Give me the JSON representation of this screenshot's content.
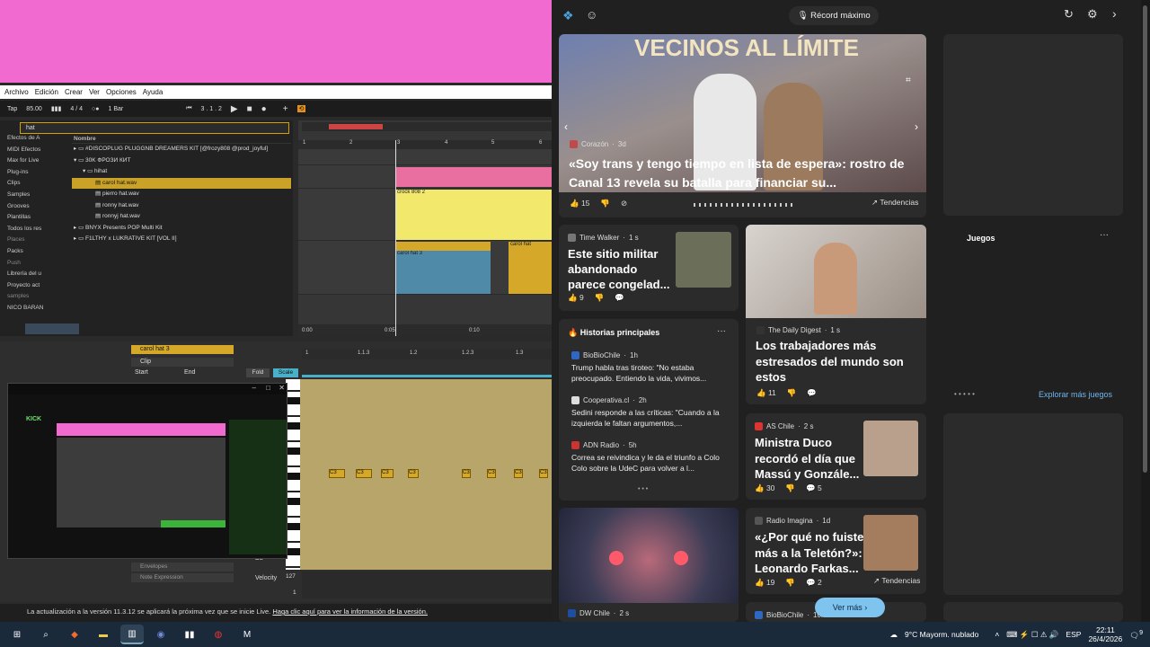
{
  "ableton": {
    "menu": [
      "Archivo",
      "Edición",
      "Crear",
      "Ver",
      "Opciones",
      "Ayuda"
    ],
    "transport": {
      "tap": "Tap",
      "bpm": "85.00",
      "signature": "4 / 4",
      "bar_mode": "1 Bar",
      "position": "3 . 1 . 2"
    },
    "search": {
      "value": "hat"
    },
    "places_top": [
      "Efectos de A",
      "MIDI Efectos",
      "Max for Live",
      "Plug-ins",
      "Clips",
      "Samples",
      "Grooves",
      "Plantillas",
      "Todos los res"
    ],
    "places_header": "Places",
    "places_bottom": [
      "Packs",
      "Push",
      "Librería del u",
      "Proyecto act",
      "samples",
      "NICO BARAN"
    ],
    "file_header": "Nombre",
    "files": [
      "#DISCOPLUG PLUGGNB DREAMERS KIT [@frozy808 @prod_joyful]",
      "30K ФРОЗИ КИТ",
      "hihat",
      "carol hat.wav",
      "pierro hat.wav",
      "ronny hat.wav",
      "ronnyj hat.wav",
      "BNYX Presents POP Multi Kit",
      "F1LTHY x LUKRATIVE KIT [VOL II]"
    ],
    "ruler": [
      "1",
      "2",
      "3",
      "4",
      "5",
      "6"
    ],
    "clips": {
      "c1": "crock 808 2",
      "c2": "carol hat 3",
      "c3": "carol hat"
    },
    "time_marks": [
      "0:00",
      "0:05",
      "0:10"
    ],
    "clip_panel": {
      "name": "carol hat 3",
      "clip": "Clip",
      "start": "Start",
      "end": "End"
    },
    "midi_ruler": [
      "1",
      "1.1.3",
      "1.2",
      "1.2.3",
      "1.3"
    ],
    "fold": "Fold",
    "scale": "Scale",
    "notes": [
      "C3",
      "C3",
      "C3",
      "C3",
      "C3",
      "C3",
      "C3",
      "C3"
    ],
    "envelopes": "Envelopes",
    "note_expression": "Note Expression",
    "velocity": "Velocity",
    "vel_max": "127",
    "vel_min": "1",
    "d2": "D2",
    "status": "La actualización a la versión 11.3.12 se aplicará la próxima vez que se inicie Live.",
    "status_link": "Haga clic aquí para ver la información de la versión.",
    "kick_title": "KICK"
  },
  "msn": {
    "search_pill": "Récord máximo",
    "hero": {
      "source": "Corazón",
      "age": "3d",
      "title": "«Soy trans y tengo tiempo en lista de espera»: rostro de Canal 13 revela su batalla para financiar su...",
      "likes": "15",
      "trend": "Tendencias",
      "banner": "VECINOS AL LÍMITE"
    },
    "card_military": {
      "source": "Time Walker",
      "age": "1 s",
      "title": "Este sitio militar abandonado parece congelad...",
      "likes": "9"
    },
    "card_workers": {
      "source": "The Daily Digest",
      "age": "1 s",
      "title": "Los trabajadores más estresados del mundo son estos",
      "likes": "11"
    },
    "historias": {
      "header": "Historias principales",
      "items": [
        {
          "source": "BioBioChile",
          "age": "1h",
          "text": "Trump habla tras tiroteo: \"No estaba preocupado. Entiendo la vida, vivimos..."
        },
        {
          "source": "Cooperativa.cl",
          "age": "2h",
          "text": "Sedini responde a las críticas: \"Cuando a la izquierda le faltan argumentos,..."
        },
        {
          "source": "ADN Radio",
          "age": "5h",
          "text": "Correa se reivindica y le da el triunfo a Colo Colo sobre la UdeC para volver a l..."
        }
      ]
    },
    "card_duco": {
      "source": "AS Chile",
      "age": "2 s",
      "title": "Ministra Duco recordó el día que Massú y Gonzále...",
      "likes": "30",
      "comments": "5"
    },
    "card_farkas": {
      "source": "Radio Imagina",
      "age": "1d",
      "title": "«¿Por qué no fuiste más a la Teletón?»: Leonardo Farkas...",
      "likes": "19",
      "comments": "2",
      "trend": "Tendencias"
    },
    "card_dw": {
      "source": "DW Chile",
      "age": "2 s"
    },
    "card_bio2": {
      "source": "BioBioChile",
      "age": "10h"
    },
    "juegos": {
      "title": "Juegos",
      "explore": "Explorar más juegos"
    },
    "ver_mas": "Ver más"
  },
  "taskbar": {
    "weather": "9°C  Mayorm. nublado",
    "lang": "ESP",
    "time": "22:11",
    "date": "26/4/2026",
    "notif_count": "9"
  },
  "colors": {
    "pink": "#f06ad0",
    "ableton_yellow": "#f2e86b",
    "hat_pink": "#e86fa0",
    "hat_blue": "#4f8aa8",
    "clip_gold": "#d5a829",
    "msn_bg": "#202020",
    "accent_blue": "#4aa3e0"
  }
}
